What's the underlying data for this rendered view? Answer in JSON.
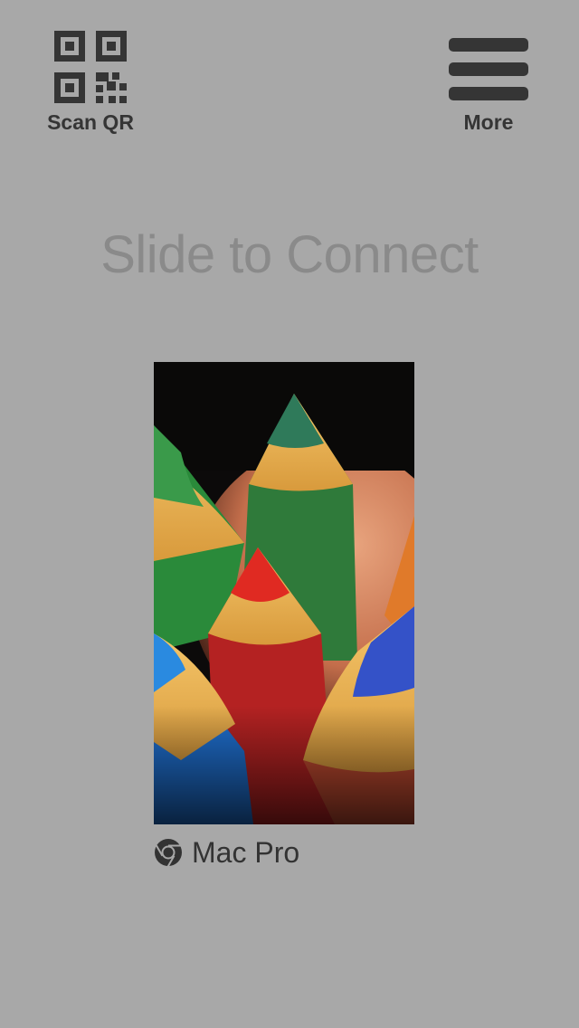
{
  "header": {
    "scan_qr": {
      "label": "Scan QR",
      "icon": "qr-code-icon"
    },
    "more": {
      "label": "More",
      "icon": "hamburger-menu-icon"
    }
  },
  "main": {
    "headline": "Slide to Connect",
    "device": {
      "name": "Mac Pro",
      "icon": "chrome-icon",
      "thumbnail": "colored-pencils-wallpaper"
    }
  },
  "colors": {
    "background": "#a8a8a8",
    "icon_dark": "#353535",
    "headline": "#8a8a8a"
  }
}
